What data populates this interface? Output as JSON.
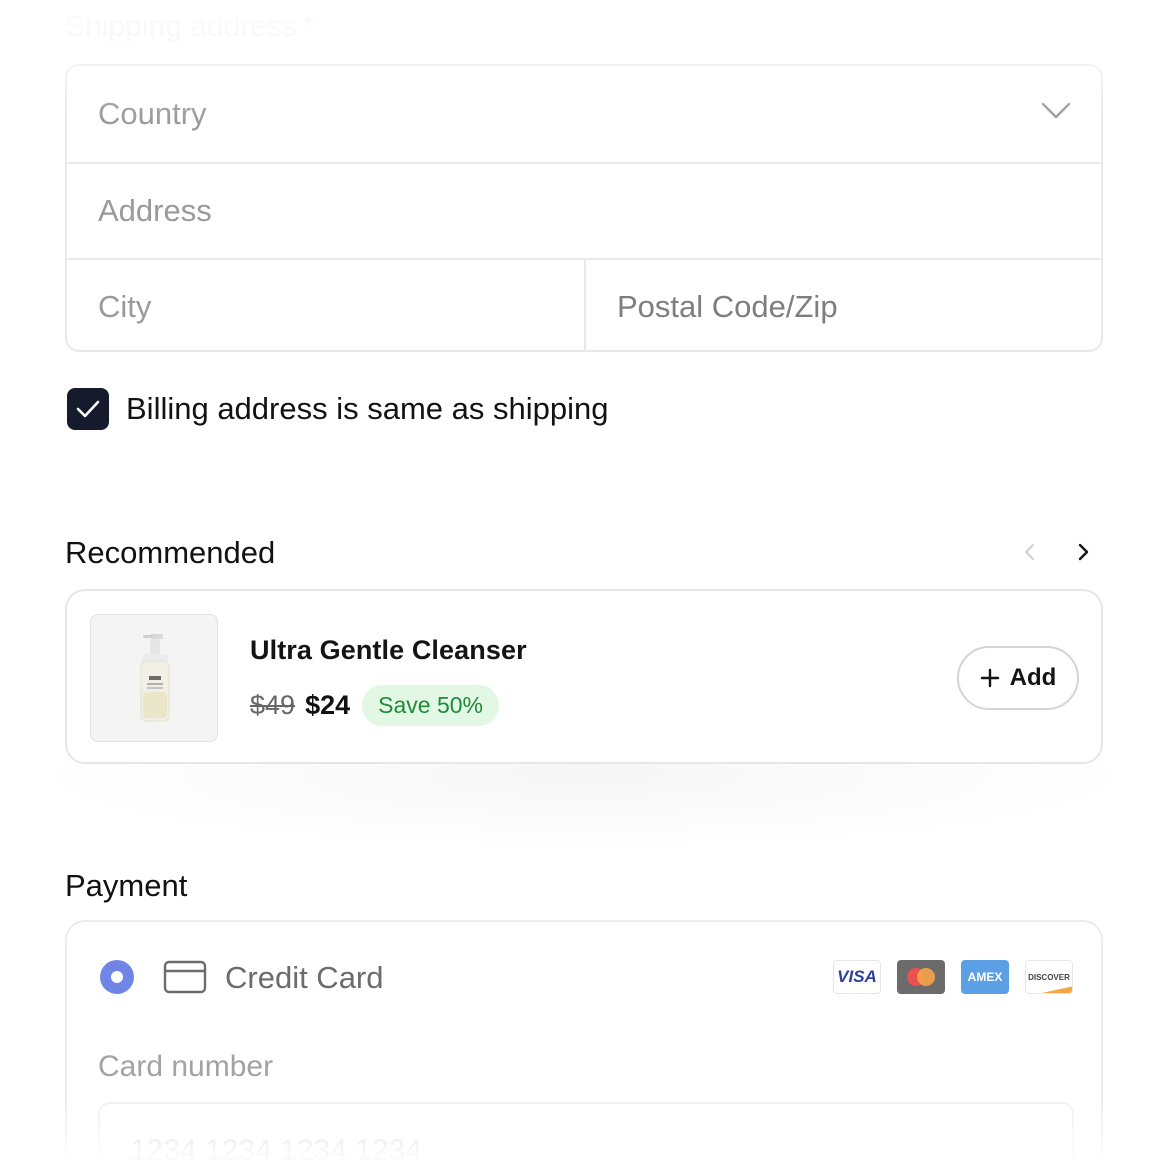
{
  "shipping": {
    "heading": "Shipping address",
    "required_mark": "*",
    "country_placeholder": "Country",
    "address_placeholder": "Address",
    "city_placeholder": "City",
    "postal_placeholder": "Postal Code/Zip"
  },
  "billing": {
    "label": "Billing address is same as shipping",
    "checked": true
  },
  "recommended": {
    "title": "Recommended",
    "product": {
      "name": "Ultra Gentle Cleanser",
      "old_price": "$49",
      "new_price": "$24",
      "badge": "Save 50%",
      "add_label": "Add"
    }
  },
  "payment": {
    "title": "Payment",
    "method_label": "Credit Card",
    "brands": [
      "VISA",
      "Mastercard",
      "AMEX",
      "DISCOVER"
    ],
    "card_number_label": "Card number",
    "card_number_placeholder": "1234 1234 1234 1234"
  },
  "colors": {
    "checkbox": "#151b2c",
    "radio": "#6f86e6",
    "badge_text": "#1f8a3c",
    "badge_bg": "#e3f7e5"
  }
}
